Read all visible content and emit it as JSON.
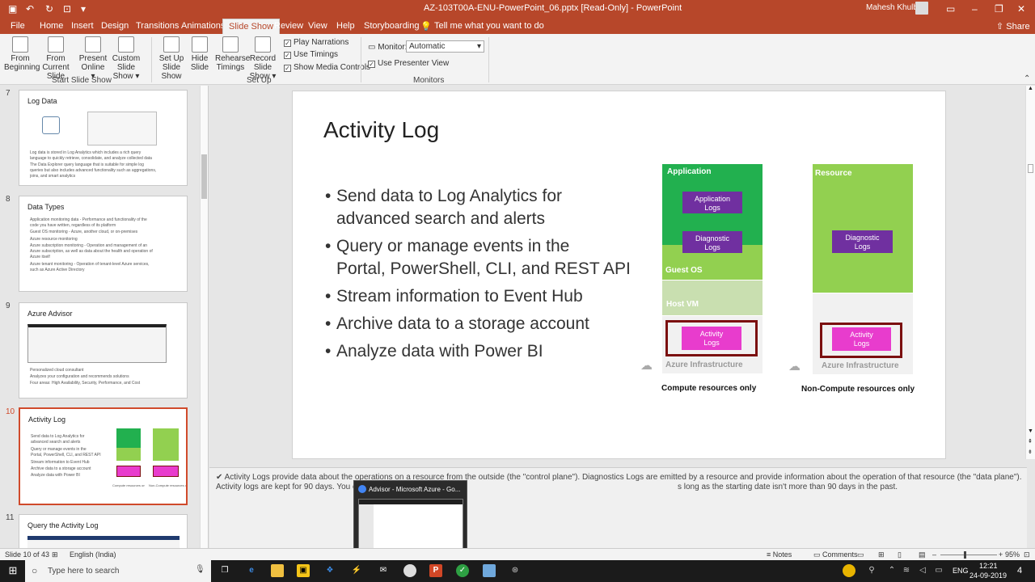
{
  "window": {
    "title": "AZ-103T00A-ENU-PowerPoint_06.pptx [Read-Only]  -  PowerPoint",
    "user": "Mahesh Khulbe",
    "share_label": "Share",
    "tell_me": "Tell me what you want to do"
  },
  "tabs": [
    "File",
    "Home",
    "Insert",
    "Design",
    "Transitions",
    "Animations",
    "Slide Show",
    "Review",
    "View",
    "Help",
    "Storyboarding"
  ],
  "ribbon": {
    "from_beginning": [
      "From",
      "Beginning"
    ],
    "from_current": [
      "From",
      "Current Slide"
    ],
    "present_online": [
      "Present",
      "Online ▾"
    ],
    "custom_show": [
      "Custom Slide",
      "Show ▾"
    ],
    "group_start": "Start Slide Show",
    "set_up_show": [
      "Set Up",
      "Slide Show"
    ],
    "hide_slide": [
      "Hide",
      "Slide"
    ],
    "rehearse": [
      "Rehearse",
      "Timings"
    ],
    "record": [
      "Record Slide",
      "Show ▾"
    ],
    "play_narrations": "Play Narrations",
    "use_timings": "Use Timings",
    "show_media": "Show Media Controls",
    "group_setup": "Set Up",
    "monitor_label": "Monitor:",
    "monitor_value": "Automatic",
    "presenter_view": "Use Presenter View",
    "group_monitors": "Monitors"
  },
  "thumbnails": [
    {
      "num": "7",
      "title": "Log Data",
      "lines": [
        "Log data is stored in Log Analytics which includes a rich query",
        "language to quickly retrieve, consolidate, and analyze collected data",
        "The Data Explorer query language that is suitable for simple log",
        "queries but also includes advanced functionality such as aggregations,",
        "joins, and smart analytics"
      ]
    },
    {
      "num": "8",
      "title": "Data Types",
      "lines": [
        "Application monitoring data - Performance and functionality of the",
        "code you have written, regardless of its platform",
        "Guest OS monitoring - Azure, another cloud, or on-premises",
        "Azure resource monitoring",
        "Azure subscription monitoring - Operation and management of an",
        "Azure subscription, as well as data about the health and operation of",
        "Azure itself",
        "Azure tenant monitoring - Operation of tenant-level Azure services,",
        "such as Azure Active Directory"
      ]
    },
    {
      "num": "9",
      "title": "Azure Advisor",
      "lines": [
        "Personalized cloud consultant",
        "Analyzes your configuration and recommends solutions",
        "Four areas: High Availability, Security, Performance, and Cost"
      ]
    },
    {
      "num": "10",
      "title": "Activity Log",
      "lines": [
        "Send data to Log Analytics for",
        "advanced search and alerts",
        "Query or manage events in the",
        "Portal, PowerShell, CLI, and REST API",
        "Stream information to Event Hub",
        "Archive data to a storage account",
        "Analyze data with Power BI"
      ]
    },
    {
      "num": "11",
      "title": "Query the Activity Log",
      "lines": []
    }
  ],
  "slide": {
    "title": "Activity Log",
    "bullets": [
      [
        "Send data to Log Analytics for",
        "advanced search and alerts"
      ],
      [
        "Query or manage events in the",
        "Portal, PowerShell, CLI, and REST API"
      ],
      [
        "Stream information to Event Hub"
      ],
      [
        "Archive data to a storage account"
      ],
      [
        "Analyze data with Power BI"
      ]
    ],
    "diagram": {
      "application": "Application",
      "app_logs": [
        "Application",
        "Logs"
      ],
      "diag_logs": [
        "Diagnostic",
        "Logs"
      ],
      "guest_os": "Guest OS",
      "host_vm": "Host VM",
      "activity_logs": [
        "Activity",
        "Logs"
      ],
      "azure_infra": "Azure Infrastructure",
      "compute_caption": "Compute resources only",
      "resource": "Resource",
      "noncompute_caption": "Non-Compute resources only"
    }
  },
  "notes": {
    "line1": "✔ Activity Logs provide data about the operations on a resource from the outside (the \"control plane\"). Diagnostics Logs are emitted by a resource and provide information about the operation of that resource (the \"data plane\").",
    "line2a": "Activity logs are kept for 90 days. You c",
    "line2b": "s long as the starting date isn't more than 90 days in the past."
  },
  "popup": {
    "title": "Advisor - Microsoft Azure - Go..."
  },
  "status": {
    "slide_count": "Slide 10 of 43",
    "language": "English (India)",
    "notes": "Notes",
    "comments": "Comments",
    "zoom": "95%"
  },
  "taskbar": {
    "search_placeholder": "Type here to search",
    "lang": "ENG",
    "time": "12:21",
    "date": "24-09-2019",
    "notif": "4"
  },
  "colors": {
    "accent": "#b7472a",
    "app_green": "#22b04f",
    "light_green": "#92d050",
    "purple": "#7030a0",
    "magenta": "#e83ccd",
    "maroon": "#7b1010"
  }
}
